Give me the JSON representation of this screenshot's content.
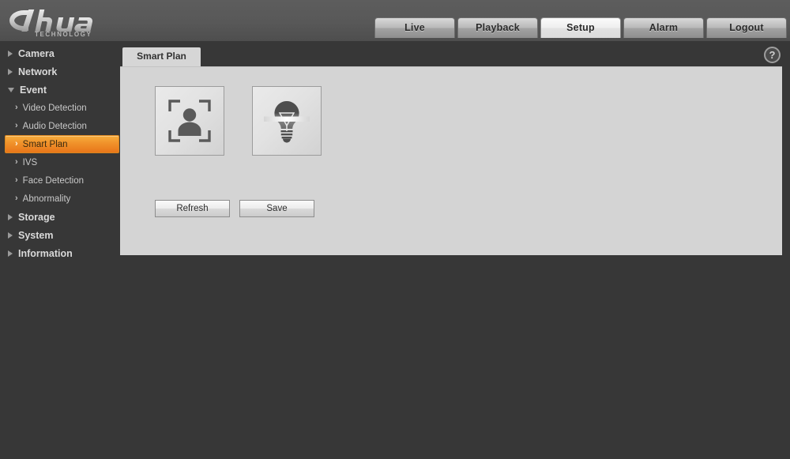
{
  "header": {
    "brand": "alhua",
    "brand_sub": "TECHNOLOGY",
    "nav_tabs": [
      {
        "label": "Live",
        "active": false
      },
      {
        "label": "Playback",
        "active": false
      },
      {
        "label": "Setup",
        "active": true
      },
      {
        "label": "Alarm",
        "active": false
      },
      {
        "label": "Logout",
        "active": false
      }
    ]
  },
  "sidebar": {
    "groups": [
      {
        "label": "Camera",
        "expanded": false,
        "children": []
      },
      {
        "label": "Network",
        "expanded": false,
        "children": []
      },
      {
        "label": "Event",
        "expanded": true,
        "children": [
          {
            "label": "Video Detection",
            "selected": false
          },
          {
            "label": "Audio Detection",
            "selected": false
          },
          {
            "label": "Smart Plan",
            "selected": true
          },
          {
            "label": "IVS",
            "selected": false
          },
          {
            "label": "Face Detection",
            "selected": false
          },
          {
            "label": "Abnormality",
            "selected": false
          }
        ]
      },
      {
        "label": "Storage",
        "expanded": false,
        "children": []
      },
      {
        "label": "System",
        "expanded": false,
        "children": []
      },
      {
        "label": "Information",
        "expanded": false,
        "children": []
      }
    ]
  },
  "panel": {
    "tabs": [
      {
        "label": "Smart Plan",
        "active": true
      }
    ],
    "help_label": "?",
    "plan_options": [
      {
        "icon": "face-detection-icon",
        "name": "face-detection"
      },
      {
        "icon": "lightbulb-icon",
        "name": "smart-lightbulb"
      }
    ],
    "buttons": [
      {
        "label": "Refresh",
        "name": "refresh-button"
      },
      {
        "label": "Save",
        "name": "save-button"
      }
    ]
  },
  "colors": {
    "accent_orange": "#f0912a",
    "page_background": "#373737",
    "panel_background": "#d4d4d4",
    "header_gray": "#585858"
  }
}
